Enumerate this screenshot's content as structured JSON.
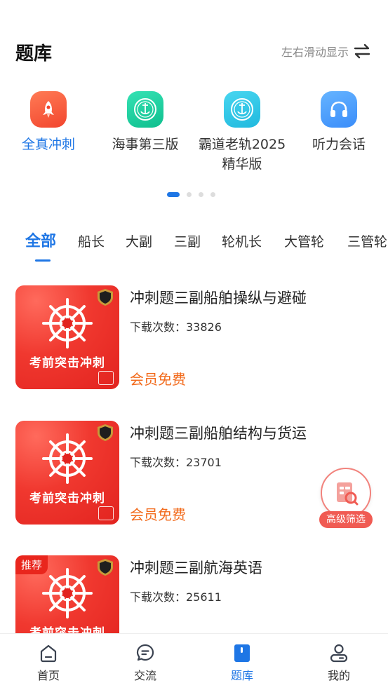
{
  "header": {
    "title": "题库",
    "swipe_hint": "左右滑动显示",
    "swipe_icon": "swap-arrows-icon"
  },
  "categories": [
    {
      "label": "全真冲刺",
      "icon": "rocket-icon",
      "color": "#f2452e",
      "active": true
    },
    {
      "label": "海事第三版",
      "icon": "maritime-emblem-icon",
      "color": "#0fbf8e",
      "active": false
    },
    {
      "label": "霸道老轨2025\n精华版",
      "line1": "霸道老轨2025",
      "line2": "精华版",
      "icon": "maritime-emblem-icon",
      "color": "#20b9de",
      "active": false
    },
    {
      "label": "听力会话",
      "icon": "headphones-icon",
      "color": "#3a8dfa",
      "active": false
    }
  ],
  "pager": {
    "total": 4,
    "current": 1
  },
  "tabs": [
    "全部",
    "船长",
    "大副",
    "三副",
    "轮机长",
    "大管轮",
    "三管轮"
  ],
  "active_tab": "全部",
  "cover": {
    "banner": "考前突击冲刺",
    "badge": "推荐"
  },
  "items": [
    {
      "title": "冲刺题三副船舶操纵与避碰",
      "count": "下载次数：33826",
      "price": "会员免费",
      "tag": ""
    },
    {
      "title": "冲刺题三副船舶结构与货运",
      "count": "下载次数：23701",
      "price": "会员免费",
      "tag": ""
    },
    {
      "title": "冲刺题三副航海英语",
      "count": "下载次数：25611",
      "price": "",
      "tag": "推荐"
    }
  ],
  "filter_button": {
    "label": "高级筛选"
  },
  "bottom_nav": [
    {
      "label": "首页",
      "icon": "home-icon",
      "active": false
    },
    {
      "label": "交流",
      "icon": "chat-icon",
      "active": false
    },
    {
      "label": "题库",
      "icon": "book-icon",
      "active": true
    },
    {
      "label": "我的",
      "icon": "profile-icon",
      "active": false
    }
  ],
  "colors": {
    "accent": "#1e76e5",
    "price": "#f26b1d",
    "cover_red": "#e2231f",
    "filter": "#f05b53"
  }
}
